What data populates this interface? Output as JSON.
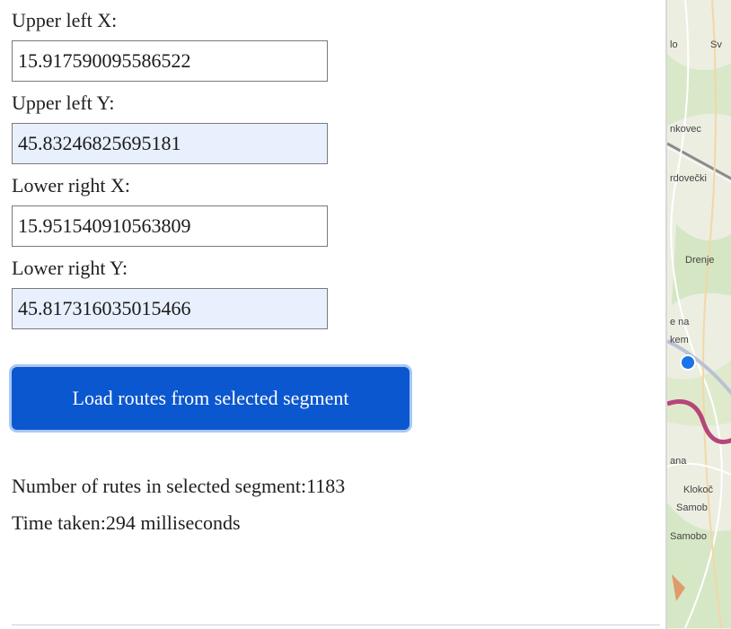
{
  "form": {
    "upper_left_x": {
      "label": "Upper left X:",
      "value": "15.917590095586522"
    },
    "upper_left_y": {
      "label": "Upper left Y:",
      "value": "45.83246825695181"
    },
    "lower_right_x": {
      "label": "Lower right X:",
      "value": "15.951540910563809"
    },
    "lower_right_y": {
      "label": "Lower right Y:",
      "value": "45.817316035015466"
    },
    "load_button": "Load routes from selected segment"
  },
  "results": {
    "route_count": "Number of rutes in selected segment:1183",
    "time_taken": "Time taken:294 milliseconds"
  },
  "map": {
    "labels": [
      "lo",
      "Sv",
      "nkovec",
      "rdovečki",
      "Drenje",
      "e na",
      "kem",
      "ana",
      "Klokoč",
      "Samob",
      "Samobo"
    ],
    "marker_color": "#1a73e8",
    "route_color": "#b5467a"
  },
  "colors": {
    "button_bg": "#0b57d0",
    "autofill_bg": "#e8f0fe"
  }
}
